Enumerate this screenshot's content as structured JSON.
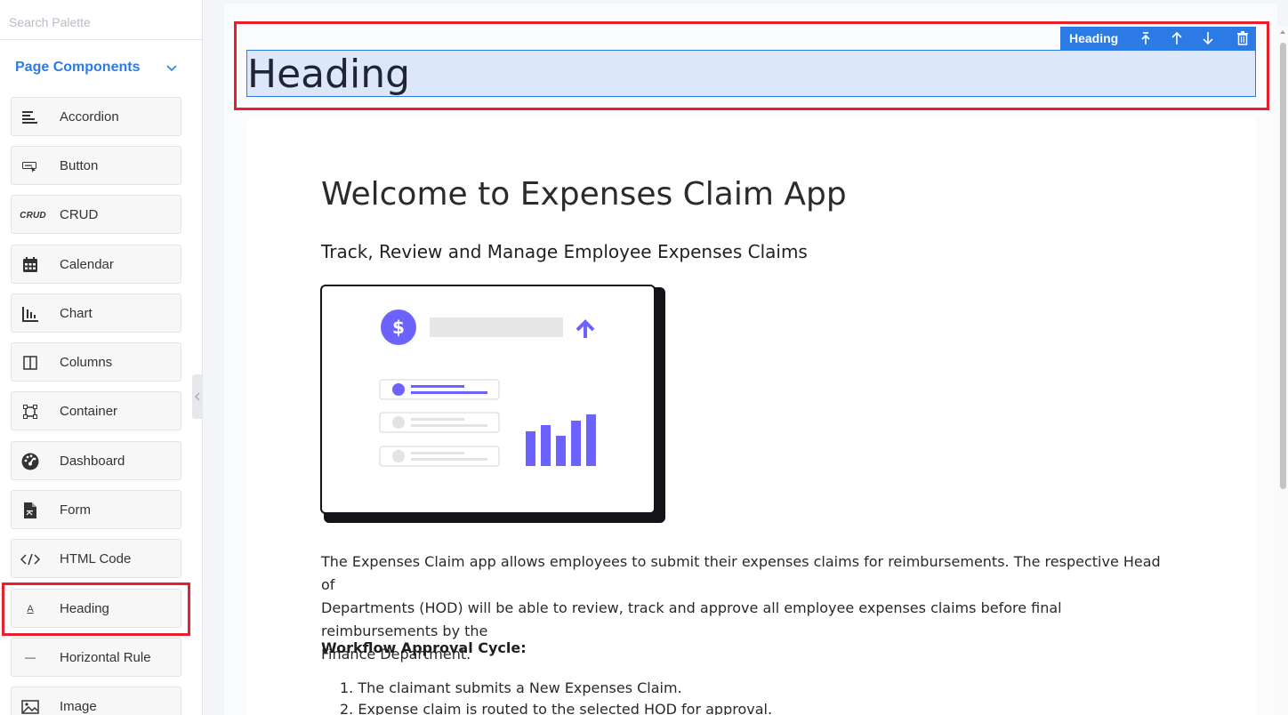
{
  "sidebar": {
    "search_placeholder": "Search Palette",
    "section_title": "Page Components",
    "items": [
      {
        "label": "Accordion",
        "icon": "accordion-icon"
      },
      {
        "label": "Button",
        "icon": "button-icon"
      },
      {
        "label": "CRUD",
        "icon": "crud-icon",
        "icon_text": "CRUD"
      },
      {
        "label": "Calendar",
        "icon": "calendar-icon"
      },
      {
        "label": "Chart",
        "icon": "chart-icon"
      },
      {
        "label": "Columns",
        "icon": "columns-icon"
      },
      {
        "label": "Container",
        "icon": "container-icon"
      },
      {
        "label": "Dashboard",
        "icon": "dashboard-icon"
      },
      {
        "label": "Form",
        "icon": "form-icon"
      },
      {
        "label": "HTML Code",
        "icon": "html-code-icon"
      },
      {
        "label": "Heading",
        "icon": "heading-icon",
        "icon_text": "A"
      },
      {
        "label": "Horizontal Rule",
        "icon": "horizontal-rule-icon"
      },
      {
        "label": "Image",
        "icon": "image-icon"
      }
    ]
  },
  "canvas": {
    "toolbar": {
      "label": "Heading",
      "buttons": [
        "select-parent-icon",
        "move-up-icon",
        "move-down-icon",
        "delete-icon"
      ]
    },
    "heading_text": "Heading",
    "content": {
      "title": "Welcome to Expenses Claim App",
      "subtitle": "Track, Review and Manage Employee Expenses Claims",
      "paragraph_line1": "The Expenses Claim app allows employees to submit their expenses claims for reimbursements. The respective Head of",
      "paragraph_line2": "Departments (HOD) will be able to review, track and approve all employee expenses claims before final reimbursements by the",
      "paragraph_line3": "Finance Department.",
      "workflow_title": "Workflow Approval Cycle:",
      "steps": [
        "1. The claimant submits a New Expenses Claim.",
        "2. Expense claim is routed to the selected HOD for approval."
      ],
      "illustration_symbol": "$"
    }
  },
  "colors": {
    "accent": "#2c7be5",
    "highlight": "#e8202e",
    "illustration": "#6c63ff"
  }
}
